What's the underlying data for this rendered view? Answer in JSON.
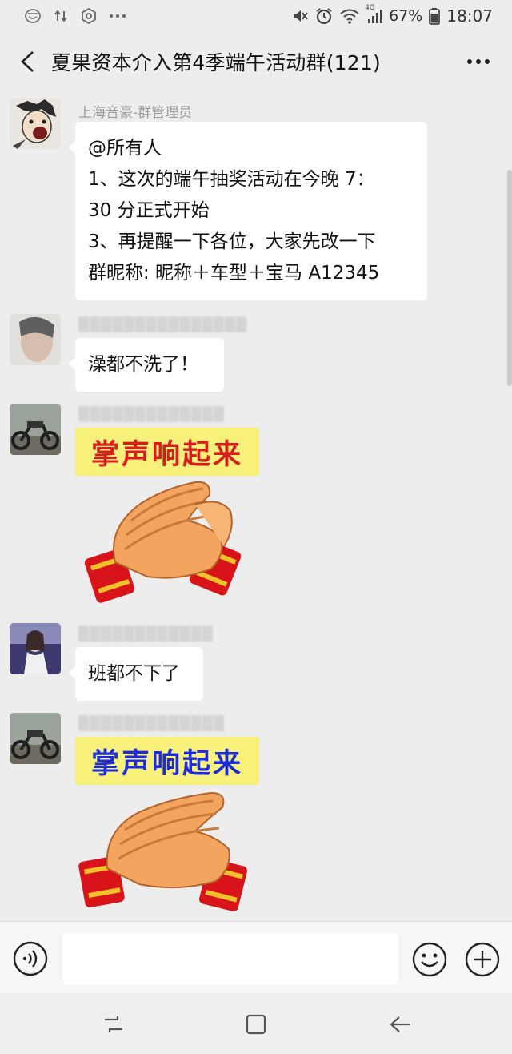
{
  "status_bar": {
    "battery_percent": "67%",
    "time": "18:07",
    "network_label": "4G"
  },
  "header": {
    "title": "夏果资本介入第4季端午活动群(121)"
  },
  "messages": [
    {
      "sender": "上海音豪-群管理员",
      "lines": [
        "@所有人",
        "1、这次的端午抽奖活动在今晚 7：",
        "30 分正式开始",
        "3、再提醒一下各位，大家先改一下",
        "群昵称: 昵称＋车型＋宝马 A12345"
      ]
    },
    {
      "sender": "",
      "lines": [
        "澡都不洗了！"
      ]
    },
    {
      "sender": "",
      "sticker_text": "掌声响起来"
    },
    {
      "sender": "",
      "lines": [
        "班都不下了"
      ]
    },
    {
      "sender": "",
      "sticker_text": "掌声响起来"
    }
  ],
  "colors": {
    "background": "#ededed",
    "bubble": "#ffffff",
    "sticker_banner": "#f7f07a",
    "sticker_text_red": "#d81d1d",
    "sticker_text_blue": "#1d2bd8"
  },
  "icons": {
    "status_left": [
      "emoji-status-icon",
      "data-transfer-icon",
      "settings-hex-icon",
      "more-dots-icon"
    ],
    "status_right": [
      "mute-icon",
      "alarm-icon",
      "wifi-icon",
      "signal-icon",
      "battery-icon"
    ],
    "input_bar": [
      "voice-icon",
      "emoji-icon",
      "plus-icon"
    ],
    "nav_bar": [
      "recents-icon",
      "home-icon",
      "back-arrow-icon"
    ]
  }
}
